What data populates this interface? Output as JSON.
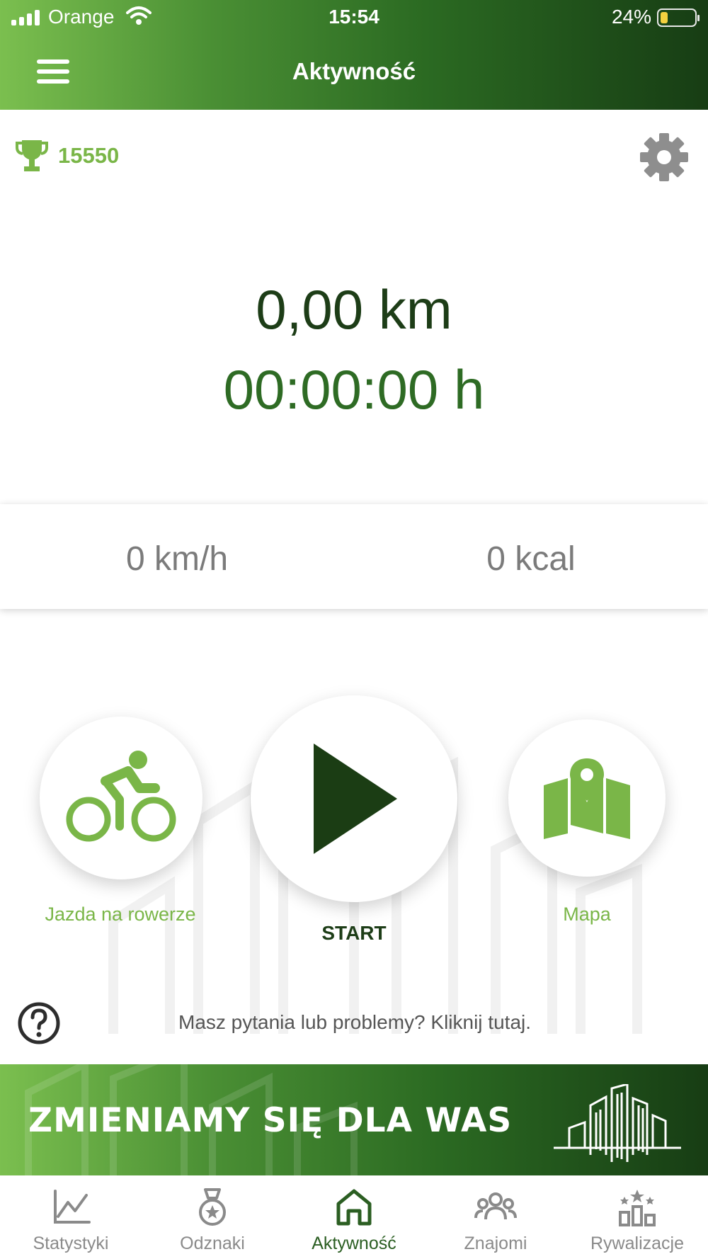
{
  "status_bar": {
    "carrier": "Orange",
    "time": "15:54",
    "battery": "24%"
  },
  "header": {
    "title": "Aktywność"
  },
  "trophy": {
    "count": "15550"
  },
  "activity": {
    "distance": "0,00 km",
    "duration": "00:00:00 h"
  },
  "stats": {
    "speed": "0 km/h",
    "calories": "0 kcal"
  },
  "actions": {
    "bike_label": "Jazda na rowerze",
    "start_label": "START",
    "map_label": "Mapa"
  },
  "help": {
    "text": "Masz pytania lub problemy? Kliknij tutaj."
  },
  "banner": {
    "text": "ZMIENIAMY SIĘ DLA WAS"
  },
  "tabs": [
    {
      "label": "Statystyki",
      "icon": "chart-icon"
    },
    {
      "label": "Odznaki",
      "icon": "medal-icon"
    },
    {
      "label": "Aktywność",
      "icon": "home-icon"
    },
    {
      "label": "Znajomi",
      "icon": "friends-icon"
    },
    {
      "label": "Rywalizacje",
      "icon": "podium-icon"
    }
  ],
  "colors": {
    "accent_green": "#7ab648",
    "dark_green": "#1d3d17",
    "tab_inactive": "#8a8a8a"
  }
}
